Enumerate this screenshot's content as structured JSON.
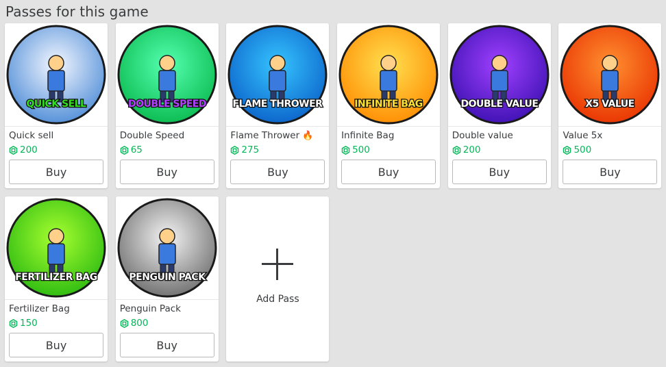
{
  "section_title": "Passes for this game",
  "buy_label": "Buy",
  "add_pass_label": "Add Pass",
  "currency_icon": "robux-icon",
  "price_color": "#02b757",
  "passes": [
    {
      "name": "Quick sell",
      "price": "200",
      "art_text": "QUICK SELL",
      "art_color": "#30e020",
      "bg": [
        "#f4f7ff",
        "#4a8ad6"
      ],
      "icon": "quick-sell-icon"
    },
    {
      "name": "Double Speed",
      "price": "65",
      "art_text": "DOUBLE SPEED",
      "art_color": "#b040ff",
      "bg": [
        "#55ffb0",
        "#08b84c"
      ],
      "icon": "double-speed-icon"
    },
    {
      "name": "Flame Thrower",
      "name_emoji": "🔥",
      "price": "275",
      "art_text": "FLAME THROWER",
      "art_color": "#ffffff",
      "bg": [
        "#36c4ff",
        "#0a60c8"
      ],
      "icon": "flame-thrower-icon"
    },
    {
      "name": "Infinite Bag",
      "price": "500",
      "art_text": "INFINITE BAG",
      "art_color": "#ffe030",
      "bg": [
        "#ffe050",
        "#ff8a00"
      ],
      "icon": "infinite-bag-icon"
    },
    {
      "name": "Double value",
      "price": "200",
      "art_text": "DOUBLE VALUE",
      "art_color": "#ffffff",
      "bg": [
        "#a040ff",
        "#3a10b0"
      ],
      "icon": "double-value-icon"
    },
    {
      "name": "Value 5x",
      "price": "500",
      "art_text": "X5 VALUE",
      "art_color": "#ffffff",
      "bg": [
        "#ff9030",
        "#e83000"
      ],
      "icon": "value-5x-icon"
    },
    {
      "name": "Fertilizer Bag",
      "price": "150",
      "art_text": "FERTILIZER BAG",
      "art_color": "#ffffff",
      "bg": [
        "#a8ff30",
        "#28b810"
      ],
      "icon": "fertilizer-bag-icon"
    },
    {
      "name": "Penguin Pack",
      "price": "800",
      "art_text": "PENGUIN PACK",
      "art_color": "#ffffff",
      "bg": [
        "#f4f4f4",
        "#6a6a6a"
      ],
      "icon": "penguin-pack-icon"
    }
  ]
}
